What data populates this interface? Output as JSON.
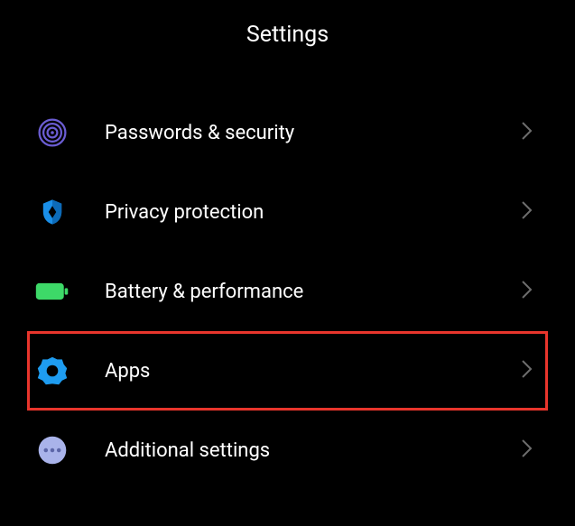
{
  "header": {
    "title": "Settings"
  },
  "items": [
    {
      "label": "Passwords & security",
      "icon": "fingerprint-icon",
      "color": "#6b5dd3"
    },
    {
      "label": "Privacy protection",
      "icon": "shield-icon",
      "color": "#2196f3"
    },
    {
      "label": "Battery & performance",
      "icon": "battery-icon",
      "color": "#3dd968"
    },
    {
      "label": "Apps",
      "icon": "gear-icon",
      "color": "#1e9cf0",
      "highlighted": true
    },
    {
      "label": "Additional settings",
      "icon": "dots-icon",
      "color": "#a9b3ea"
    }
  ]
}
